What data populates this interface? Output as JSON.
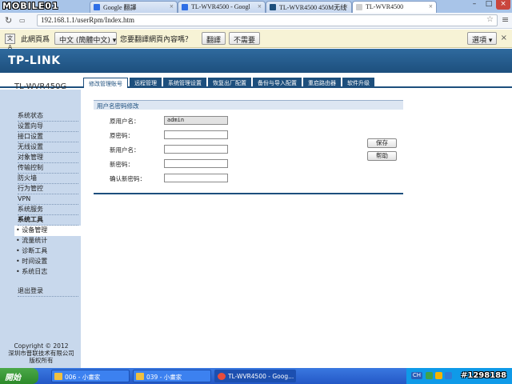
{
  "watermark_logo": "MOBILE01",
  "watermark_id": "#1298188",
  "browser": {
    "tabs": [
      {
        "label": "Google 翻譯",
        "fav": "#2e6ee6"
      },
      {
        "label": "TL-WVR4500 - Googl",
        "fav": "#2e6ee6"
      },
      {
        "label": "TL-WVR4500 450M无线",
        "fav": "#1d4f7d"
      },
      {
        "label": "TL-WVR4500",
        "fav": "#cfcfcf"
      }
    ],
    "url": "192.168.1.1/userRpm/Index.htm",
    "translate": {
      "label1": "此網頁爲",
      "lang": "中文 (簡體中文)",
      "question": "您要翻譯網頁內容嗎？",
      "translate_btn": "翻譯",
      "no_btn": "不需要",
      "options_btn": "選項"
    }
  },
  "router": {
    "logo": "TP-LINK",
    "model": "TL-WVR450G",
    "tabs": [
      "修改管理账号",
      "远程管理",
      "系统管理设置",
      "恢复出厂配置",
      "备份与导入配置",
      "重启路由器",
      "软件升级"
    ],
    "sidebar": {
      "items": [
        "系统状态",
        "设置向导",
        "接口设置",
        "无线设置",
        "对象管理",
        "传输控制",
        "防火墙",
        "行为管控",
        "VPN",
        "系统服务",
        "系统工具"
      ],
      "subitems": [
        "• 设备管理",
        "• 流量统计",
        "• 诊断工具",
        "• 时间设置",
        "• 系统日志"
      ],
      "logout": "退出登录",
      "copyright": [
        "Copyright © 2012",
        "深圳市普联技术有限公司",
        "版权所有"
      ]
    },
    "form": {
      "title": "用户名密码修改",
      "fields": [
        {
          "label": "原用户名：",
          "value": "admin"
        },
        {
          "label": "原密码：",
          "value": ""
        },
        {
          "label": "新用户名：",
          "value": ""
        },
        {
          "label": "新密码：",
          "value": ""
        },
        {
          "label": "确认新密码：",
          "value": ""
        }
      ],
      "save": "保存",
      "help": "帮助"
    }
  },
  "taskbar": {
    "start": "開始",
    "tasks": [
      "006 - 小畫家",
      "039 - 小畫家",
      "TL-WVR4500 - Goog..."
    ],
    "tray": [
      "CH"
    ]
  }
}
